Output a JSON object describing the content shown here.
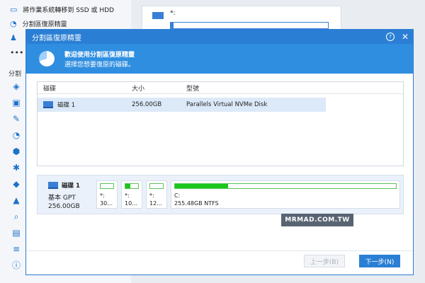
{
  "background": {
    "top_items": [
      {
        "label": "將作業系統轉移到 SSD 或 HDD",
        "icon": "monitor-icon"
      },
      {
        "label": "分割區復原精靈",
        "icon": "pie-icon"
      },
      {
        "label": "",
        "icon": "user-group-icon"
      },
      {
        "label": "",
        "icon": "more-icon"
      }
    ],
    "section_label": "分割",
    "card_label": "*:"
  },
  "dialog": {
    "title": "分割區復原精靈",
    "help": "?",
    "close": "✕",
    "banner_title": "歡迎使用分割區復原精靈",
    "banner_subtitle": "選擇您想要復原的磁碟。",
    "columns": [
      "磁碟",
      "大小",
      "型號"
    ],
    "rows": [
      {
        "disk": "磁碟 1",
        "size": "256.00GB",
        "model": "Parallels Virtual NVMe Disk"
      }
    ],
    "disk_panel": {
      "name": "磁碟 1",
      "type": "基本 GPT",
      "size": "256.00GB",
      "partitions": [
        {
          "letter": "*:",
          "detail": "30…",
          "fill": 0.0
        },
        {
          "letter": "*:",
          "detail": "10…",
          "fill": 0.4
        },
        {
          "letter": "*:",
          "detail": "12…",
          "fill": 0.0
        },
        {
          "letter": "C:",
          "detail": "255.48GB NTFS",
          "fill": 0.24
        }
      ]
    },
    "buttons": {
      "prev": "上一步(B)",
      "next": "下一步(N)"
    },
    "watermark": "MRMAD.COM.TW"
  },
  "colors": {
    "accent": "#2a7fd4",
    "banner": "#2f8ee0",
    "selection": "#dce9f8",
    "partition_fill": "#1cc71c"
  }
}
